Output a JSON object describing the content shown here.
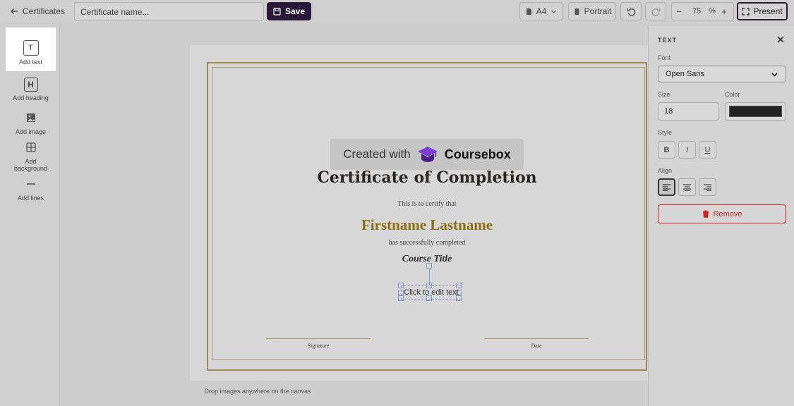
{
  "topbar": {
    "back_label": "Certificates",
    "name_placeholder": "Certificate name...",
    "save_label": "Save",
    "paper_size": "A4",
    "orientation": "Portrait",
    "zoom_value": "75",
    "zoom_unit": "%",
    "zoom_minus": "−",
    "zoom_plus": "+",
    "present_label": "Present"
  },
  "tools": [
    {
      "label": "Add text",
      "icon": "T"
    },
    {
      "label": "Add heading",
      "icon": "H"
    },
    {
      "label": "Add image",
      "icon": "image-icon"
    },
    {
      "label": "Add background",
      "icon": "grid-icon"
    },
    {
      "label": "Add lines",
      "icon": "line-icon"
    }
  ],
  "certificate": {
    "watermark_prefix": "Created with",
    "watermark_brand": "Coursebox",
    "title": "Certificate of Completion",
    "certify_text": "This is to certify that",
    "recipient": "Firstname Lastname",
    "completed_text": "has successfully completed",
    "course_title": "Course Title",
    "editable_text": "Click to edit text",
    "signature_label": "Signature",
    "date_label": "Date"
  },
  "canvas": {
    "drop_hint": "Drop images anywhere on the canvas"
  },
  "panel": {
    "title": "TEXT",
    "font_label": "Font",
    "font_value": "Open Sans",
    "size_label": "Size",
    "size_value": "18",
    "color_label": "Color",
    "color_value": "#222222",
    "style_label": "Style",
    "style_bold": "B",
    "style_italic": "I",
    "style_underline": "U",
    "align_label": "Align",
    "remove_label": "Remove"
  },
  "colors": {
    "brand": "#2a1838",
    "gold": "#8c6e11",
    "danger": "#cc2222"
  }
}
